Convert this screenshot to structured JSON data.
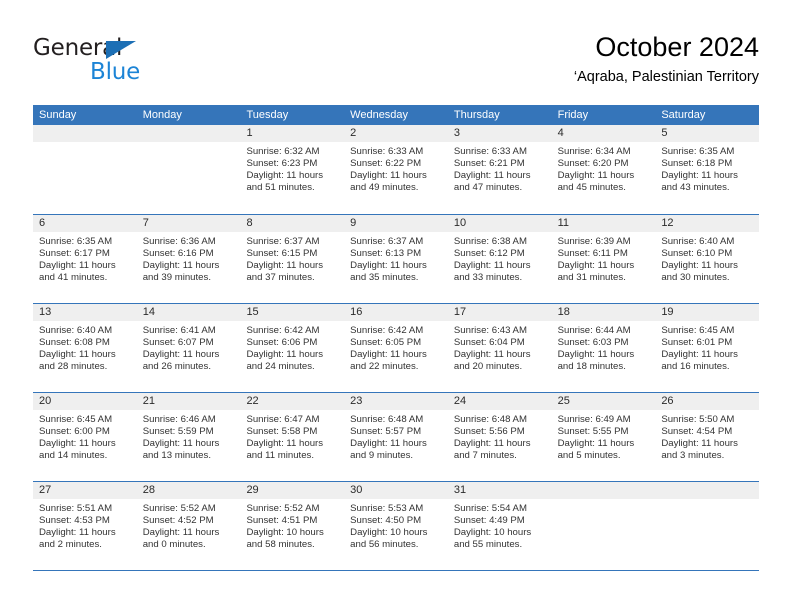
{
  "brand": {
    "name_part1": "General",
    "name_part2": "Blue",
    "triangle_color": "#1c6fb5",
    "blue_color": "#1c84d6"
  },
  "header": {
    "month_title": "October 2024",
    "location": "‘Aqraba, Palestinian Territory"
  },
  "theme": {
    "header_blue": "#3575ba",
    "day_band_gray": "#efefef",
    "text_color": "#333333"
  },
  "weekdays": [
    "Sunday",
    "Monday",
    "Tuesday",
    "Wednesday",
    "Thursday",
    "Friday",
    "Saturday"
  ],
  "weeks": [
    [
      {
        "day": "",
        "sunrise": "",
        "sunset": "",
        "daylight1": "",
        "daylight2": ""
      },
      {
        "day": "",
        "sunrise": "",
        "sunset": "",
        "daylight1": "",
        "daylight2": ""
      },
      {
        "day": "1",
        "sunrise": "Sunrise: 6:32 AM",
        "sunset": "Sunset: 6:23 PM",
        "daylight1": "Daylight: 11 hours",
        "daylight2": "and 51 minutes."
      },
      {
        "day": "2",
        "sunrise": "Sunrise: 6:33 AM",
        "sunset": "Sunset: 6:22 PM",
        "daylight1": "Daylight: 11 hours",
        "daylight2": "and 49 minutes."
      },
      {
        "day": "3",
        "sunrise": "Sunrise: 6:33 AM",
        "sunset": "Sunset: 6:21 PM",
        "daylight1": "Daylight: 11 hours",
        "daylight2": "and 47 minutes."
      },
      {
        "day": "4",
        "sunrise": "Sunrise: 6:34 AM",
        "sunset": "Sunset: 6:20 PM",
        "daylight1": "Daylight: 11 hours",
        "daylight2": "and 45 minutes."
      },
      {
        "day": "5",
        "sunrise": "Sunrise: 6:35 AM",
        "sunset": "Sunset: 6:18 PM",
        "daylight1": "Daylight: 11 hours",
        "daylight2": "and 43 minutes."
      }
    ],
    [
      {
        "day": "6",
        "sunrise": "Sunrise: 6:35 AM",
        "sunset": "Sunset: 6:17 PM",
        "daylight1": "Daylight: 11 hours",
        "daylight2": "and 41 minutes."
      },
      {
        "day": "7",
        "sunrise": "Sunrise: 6:36 AM",
        "sunset": "Sunset: 6:16 PM",
        "daylight1": "Daylight: 11 hours",
        "daylight2": "and 39 minutes."
      },
      {
        "day": "8",
        "sunrise": "Sunrise: 6:37 AM",
        "sunset": "Sunset: 6:15 PM",
        "daylight1": "Daylight: 11 hours",
        "daylight2": "and 37 minutes."
      },
      {
        "day": "9",
        "sunrise": "Sunrise: 6:37 AM",
        "sunset": "Sunset: 6:13 PM",
        "daylight1": "Daylight: 11 hours",
        "daylight2": "and 35 minutes."
      },
      {
        "day": "10",
        "sunrise": "Sunrise: 6:38 AM",
        "sunset": "Sunset: 6:12 PM",
        "daylight1": "Daylight: 11 hours",
        "daylight2": "and 33 minutes."
      },
      {
        "day": "11",
        "sunrise": "Sunrise: 6:39 AM",
        "sunset": "Sunset: 6:11 PM",
        "daylight1": "Daylight: 11 hours",
        "daylight2": "and 31 minutes."
      },
      {
        "day": "12",
        "sunrise": "Sunrise: 6:40 AM",
        "sunset": "Sunset: 6:10 PM",
        "daylight1": "Daylight: 11 hours",
        "daylight2": "and 30 minutes."
      }
    ],
    [
      {
        "day": "13",
        "sunrise": "Sunrise: 6:40 AM",
        "sunset": "Sunset: 6:08 PM",
        "daylight1": "Daylight: 11 hours",
        "daylight2": "and 28 minutes."
      },
      {
        "day": "14",
        "sunrise": "Sunrise: 6:41 AM",
        "sunset": "Sunset: 6:07 PM",
        "daylight1": "Daylight: 11 hours",
        "daylight2": "and 26 minutes."
      },
      {
        "day": "15",
        "sunrise": "Sunrise: 6:42 AM",
        "sunset": "Sunset: 6:06 PM",
        "daylight1": "Daylight: 11 hours",
        "daylight2": "and 24 minutes."
      },
      {
        "day": "16",
        "sunrise": "Sunrise: 6:42 AM",
        "sunset": "Sunset: 6:05 PM",
        "daylight1": "Daylight: 11 hours",
        "daylight2": "and 22 minutes."
      },
      {
        "day": "17",
        "sunrise": "Sunrise: 6:43 AM",
        "sunset": "Sunset: 6:04 PM",
        "daylight1": "Daylight: 11 hours",
        "daylight2": "and 20 minutes."
      },
      {
        "day": "18",
        "sunrise": "Sunrise: 6:44 AM",
        "sunset": "Sunset: 6:03 PM",
        "daylight1": "Daylight: 11 hours",
        "daylight2": "and 18 minutes."
      },
      {
        "day": "19",
        "sunrise": "Sunrise: 6:45 AM",
        "sunset": "Sunset: 6:01 PM",
        "daylight1": "Daylight: 11 hours",
        "daylight2": "and 16 minutes."
      }
    ],
    [
      {
        "day": "20",
        "sunrise": "Sunrise: 6:45 AM",
        "sunset": "Sunset: 6:00 PM",
        "daylight1": "Daylight: 11 hours",
        "daylight2": "and 14 minutes."
      },
      {
        "day": "21",
        "sunrise": "Sunrise: 6:46 AM",
        "sunset": "Sunset: 5:59 PM",
        "daylight1": "Daylight: 11 hours",
        "daylight2": "and 13 minutes."
      },
      {
        "day": "22",
        "sunrise": "Sunrise: 6:47 AM",
        "sunset": "Sunset: 5:58 PM",
        "daylight1": "Daylight: 11 hours",
        "daylight2": "and 11 minutes."
      },
      {
        "day": "23",
        "sunrise": "Sunrise: 6:48 AM",
        "sunset": "Sunset: 5:57 PM",
        "daylight1": "Daylight: 11 hours",
        "daylight2": "and 9 minutes."
      },
      {
        "day": "24",
        "sunrise": "Sunrise: 6:48 AM",
        "sunset": "Sunset: 5:56 PM",
        "daylight1": "Daylight: 11 hours",
        "daylight2": "and 7 minutes."
      },
      {
        "day": "25",
        "sunrise": "Sunrise: 6:49 AM",
        "sunset": "Sunset: 5:55 PM",
        "daylight1": "Daylight: 11 hours",
        "daylight2": "and 5 minutes."
      },
      {
        "day": "26",
        "sunrise": "Sunrise: 5:50 AM",
        "sunset": "Sunset: 4:54 PM",
        "daylight1": "Daylight: 11 hours",
        "daylight2": "and 3 minutes."
      }
    ],
    [
      {
        "day": "27",
        "sunrise": "Sunrise: 5:51 AM",
        "sunset": "Sunset: 4:53 PM",
        "daylight1": "Daylight: 11 hours",
        "daylight2": "and 2 minutes."
      },
      {
        "day": "28",
        "sunrise": "Sunrise: 5:52 AM",
        "sunset": "Sunset: 4:52 PM",
        "daylight1": "Daylight: 11 hours",
        "daylight2": "and 0 minutes."
      },
      {
        "day": "29",
        "sunrise": "Sunrise: 5:52 AM",
        "sunset": "Sunset: 4:51 PM",
        "daylight1": "Daylight: 10 hours",
        "daylight2": "and 58 minutes."
      },
      {
        "day": "30",
        "sunrise": "Sunrise: 5:53 AM",
        "sunset": "Sunset: 4:50 PM",
        "daylight1": "Daylight: 10 hours",
        "daylight2": "and 56 minutes."
      },
      {
        "day": "31",
        "sunrise": "Sunrise: 5:54 AM",
        "sunset": "Sunset: 4:49 PM",
        "daylight1": "Daylight: 10 hours",
        "daylight2": "and 55 minutes."
      },
      {
        "day": "",
        "sunrise": "",
        "sunset": "",
        "daylight1": "",
        "daylight2": ""
      },
      {
        "day": "",
        "sunrise": "",
        "sunset": "",
        "daylight1": "",
        "daylight2": ""
      }
    ]
  ]
}
